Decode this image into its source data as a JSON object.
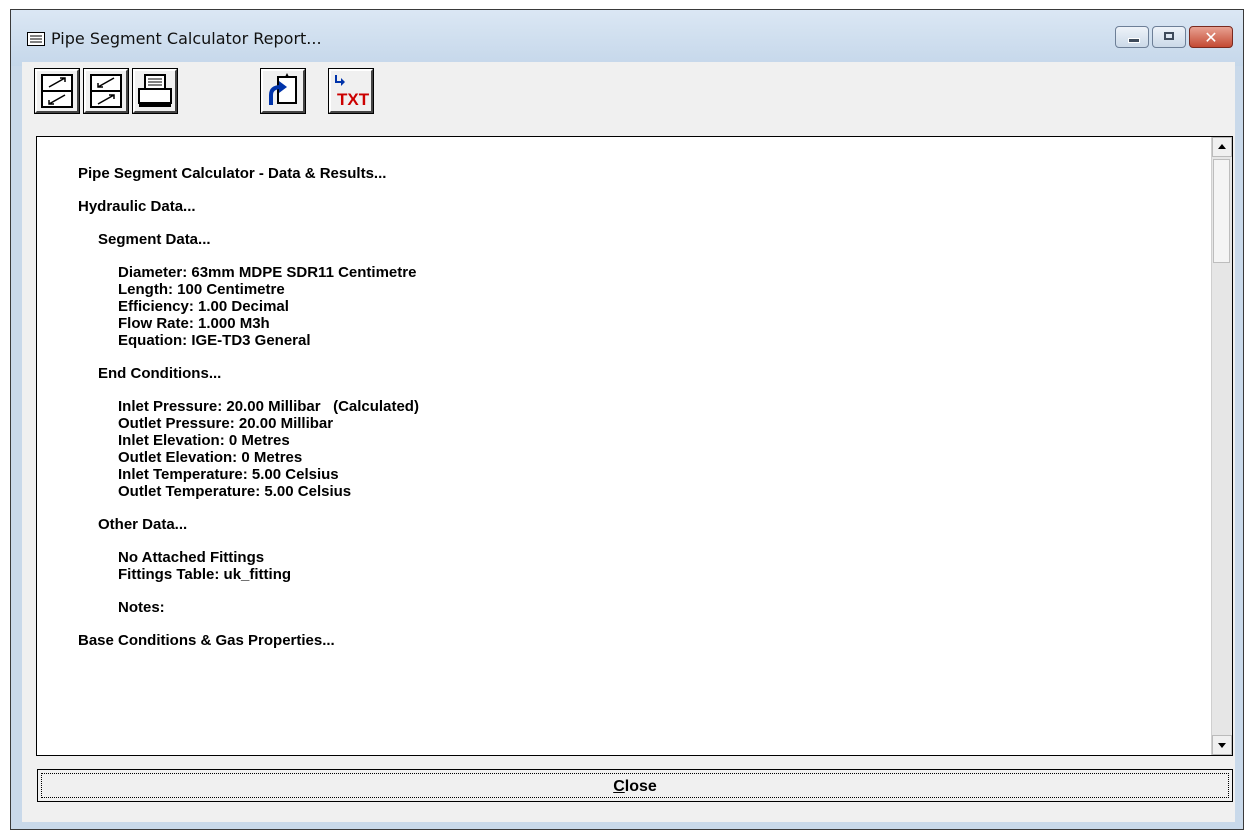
{
  "window": {
    "title": "Pipe Segment Calculator Report...",
    "close_accent": "#c44a33"
  },
  "toolbar": {
    "buttons": [
      {
        "name": "expand-all-icon"
      },
      {
        "name": "collapse-all-icon"
      },
      {
        "name": "print-icon"
      },
      {
        "name": "export-icon"
      },
      {
        "name": "export-txt-icon",
        "label": "TXT"
      }
    ]
  },
  "report": {
    "title": "Pipe Segment Calculator - Data & Results...",
    "hydraulic_heading": "Hydraulic Data...",
    "segment_heading": "Segment Data...",
    "segment_lines": [
      "Diameter: 63mm MDPE SDR11 Centimetre",
      "Length: 100 Centimetre",
      "Efficiency: 1.00 Decimal",
      "Flow Rate: 1.000 M3h",
      "Equation: IGE-TD3 General"
    ],
    "end_heading": "End Conditions...",
    "end_lines": [
      "Inlet Pressure: 20.00 Millibar   (Calculated)",
      "Outlet Pressure: 20.00 Millibar",
      "Inlet Elevation: 0 Metres",
      "Outlet Elevation: 0 Metres",
      "Inlet Temperature: 5.00 Celsius",
      "Outlet Temperature: 5.00 Celsius"
    ],
    "other_heading": "Other Data...",
    "other_lines": [
      "No Attached Fittings",
      "Fittings Table: uk_fitting"
    ],
    "notes_label": "Notes:",
    "base_heading": "Base Conditions & Gas Properties..."
  },
  "footer": {
    "close_first": "C",
    "close_rest": "lose"
  }
}
